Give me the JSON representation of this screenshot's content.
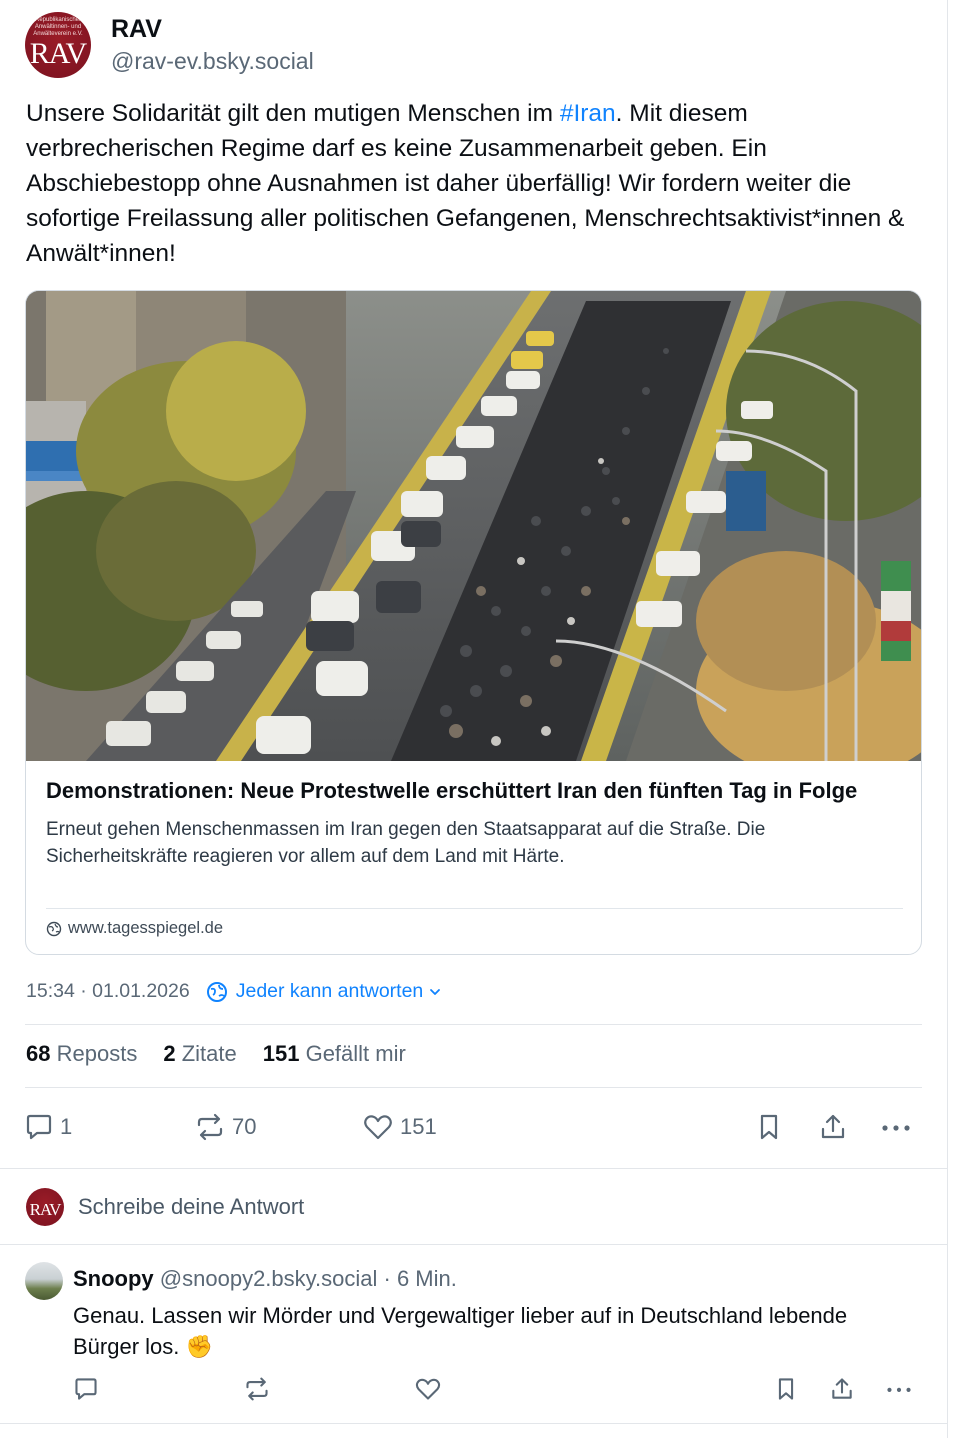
{
  "post": {
    "author": {
      "display_name": "RAV",
      "handle": "@rav-ev.bsky.social",
      "avatar_text": "RAV",
      "avatar_small_text": "Republikanischer Anwältinnen- und Anwälteverein e.V."
    },
    "text_before": "Unsere Solidarität gilt den mutigen Menschen im ",
    "hashtag": "#Iran",
    "text_after": ". Mit diesem verbrecherischen Regime darf es keine Zusammenarbeit geben. Ein Abschiebestopp ohne Ausnahmen ist daher überfällig! Wir fordern weiter die sofortige Freilassung aller politischen Gefangenen, Menschrechtsaktivist*innen & Anwält*innen!",
    "link_card": {
      "title": "Demonstrationen: Neue Protestwelle erschüttert Iran den fünften Tag in Folge",
      "description": "Erneut gehen Menschenmassen im Iran gegen den Staatsapparat auf die Straße. Die Sicherheitskräfte reagieren vor allem auf dem Land mit Härte.",
      "domain": "www.tagesspiegel.de"
    },
    "timestamp": "15:34 · 01.01.2026",
    "reply_setting": "Jeder kann antworten",
    "stats": {
      "reposts_count": "68",
      "reposts_label": "Reposts",
      "quotes_count": "2",
      "quotes_label": "Zitate",
      "likes_count": "151",
      "likes_label": "Gefällt mir"
    },
    "actions": {
      "reply_count": "1",
      "repost_count": "70",
      "like_count": "151"
    }
  },
  "reply_box": {
    "placeholder": "Schreibe deine Antwort",
    "avatar_text": "RAV"
  },
  "comments": [
    {
      "display_name": "Snoopy",
      "handle": "@snoopy2.bsky.social",
      "time": " · 6 Min.",
      "text": "Genau. Lassen wir Mörder und Vergewaltiger lieber auf in Deutschland lebende Bürger los. ✊"
    }
  ],
  "colors": {
    "accent": "#1083fe",
    "text": "#0b0f14",
    "muted": "#5a6876",
    "border": "#e3e6ea",
    "avatar_red": "#8a1722"
  }
}
